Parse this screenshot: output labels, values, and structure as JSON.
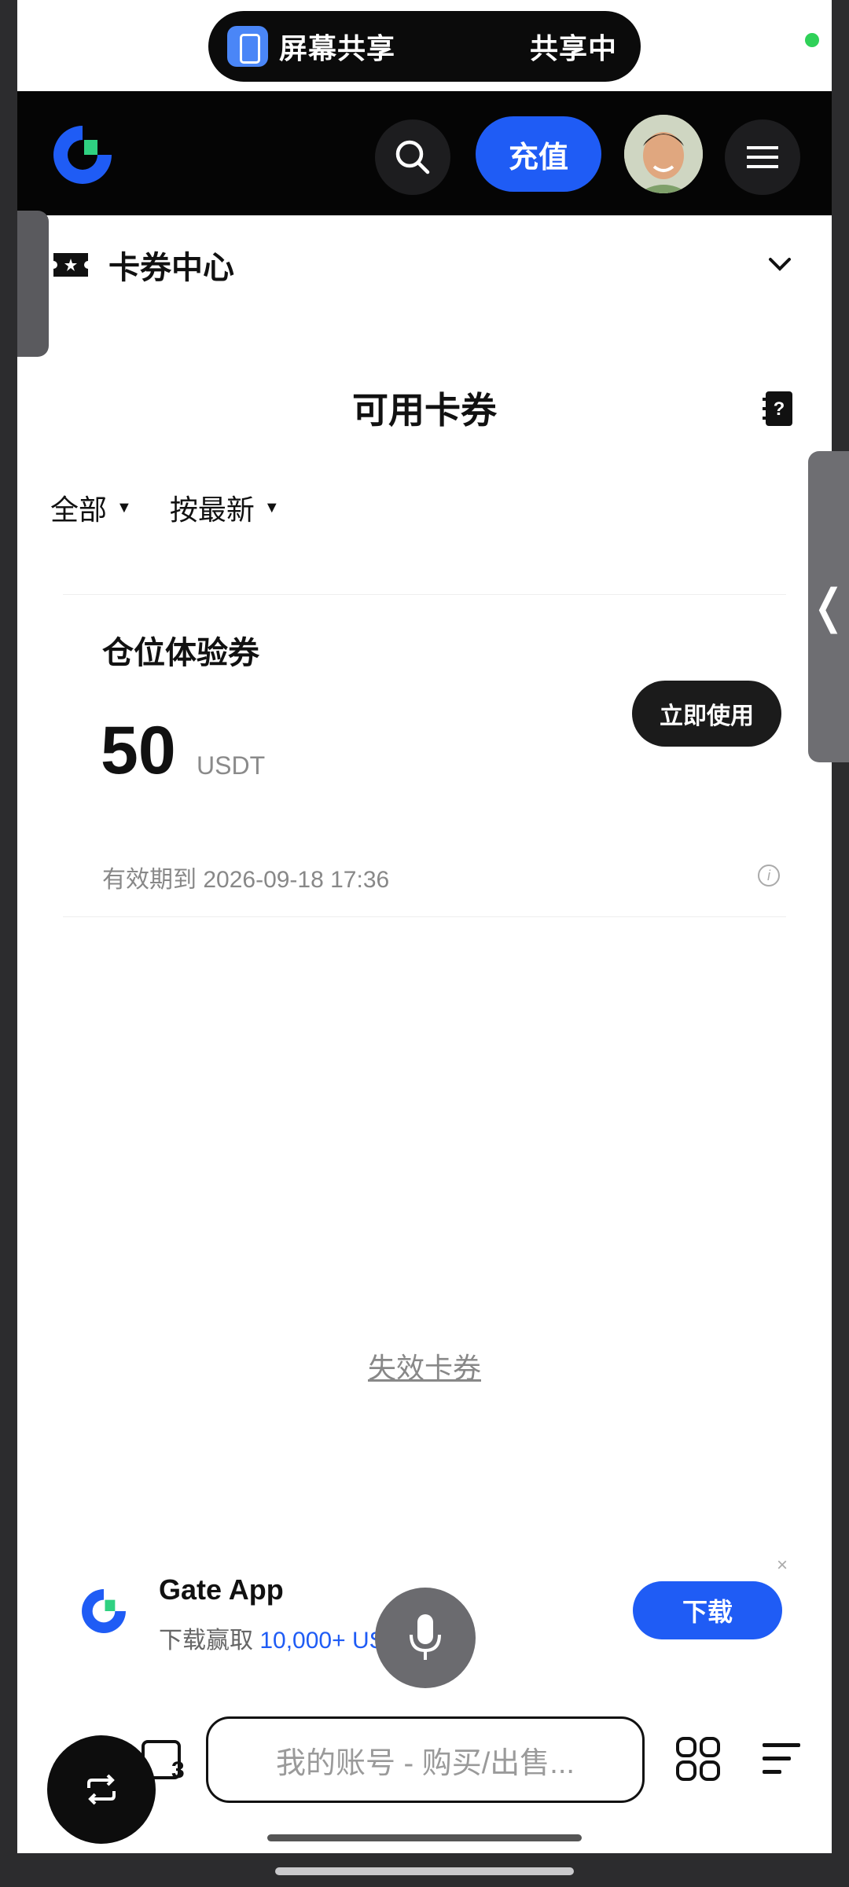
{
  "share_pill": {
    "label": "屏幕共享",
    "status": "共享中"
  },
  "header": {
    "recharge_label": "充值"
  },
  "section": {
    "title": "卡券中心"
  },
  "page": {
    "title": "可用卡券"
  },
  "filters": [
    {
      "label": "全部"
    },
    {
      "label": "按最新"
    }
  ],
  "voucher": {
    "name": "仓位体验券",
    "amount": "50",
    "unit": "USDT",
    "use_label": "立即使用",
    "expiry": "有效期到 2026-09-18 17:36"
  },
  "expired_link": "失效卡券",
  "banner": {
    "title": "Gate App",
    "subtitle_prefix": "下载赢取 ",
    "subtitle_highlight": "10,000+ USDT",
    "download_label": "下载",
    "close": "×"
  },
  "address_bar": {
    "text": "我的账号 - 购买/出售..."
  },
  "tabs_count": "3",
  "colors": {
    "accent": "#1f5cf5",
    "header_bg": "#050505"
  }
}
